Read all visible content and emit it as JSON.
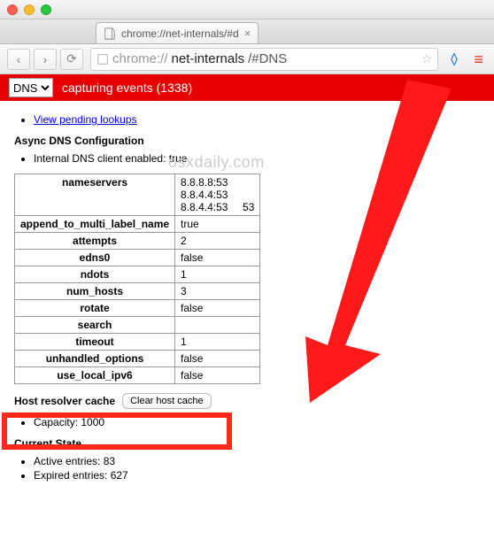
{
  "titlebar": {},
  "tab": {
    "title": "chrome://net-internals/#d",
    "close": "×"
  },
  "nav": {
    "back": "‹",
    "forward": "›",
    "reload": "⟳"
  },
  "url": {
    "scheme": "chrome://",
    "host": "net-internals",
    "path": "/#DNS"
  },
  "capbar": {
    "dropdown_value": "DNS",
    "text_prefix": "capturing events (",
    "count": "1338",
    "text_suffix": ")"
  },
  "links": {
    "view_pending": "View pending lookups"
  },
  "headings": {
    "async_cfg": "Async DNS Configuration",
    "host_cache": "Host resolver cache",
    "current_state": "Current State"
  },
  "items": {
    "internal_client": "Internal DNS client enabled: true",
    "capacity": "Capacity: 1000",
    "active": "Active entries: 83",
    "expired": "Expired entries: 627"
  },
  "table": {
    "nameservers_label": "nameservers",
    "ns1": "8.8.8.8:53",
    "ns2": "8.8.4.4:53",
    "ns3": "8.8.4.4:53",
    "ns3_extra": "53",
    "rows": [
      {
        "k": "append_to_multi_label_name",
        "v": "true"
      },
      {
        "k": "attempts",
        "v": "2"
      },
      {
        "k": "edns0",
        "v": "false"
      },
      {
        "k": "ndots",
        "v": "1"
      },
      {
        "k": "num_hosts",
        "v": "3"
      },
      {
        "k": "rotate",
        "v": "false"
      },
      {
        "k": "search",
        "v": ""
      },
      {
        "k": "timeout",
        "v": "1"
      },
      {
        "k": "unhandled_options",
        "v": "false"
      },
      {
        "k": "use_local_ipv6",
        "v": "false"
      }
    ]
  },
  "buttons": {
    "clear_cache": "Clear host cache"
  },
  "watermark": "osxdaily.com"
}
